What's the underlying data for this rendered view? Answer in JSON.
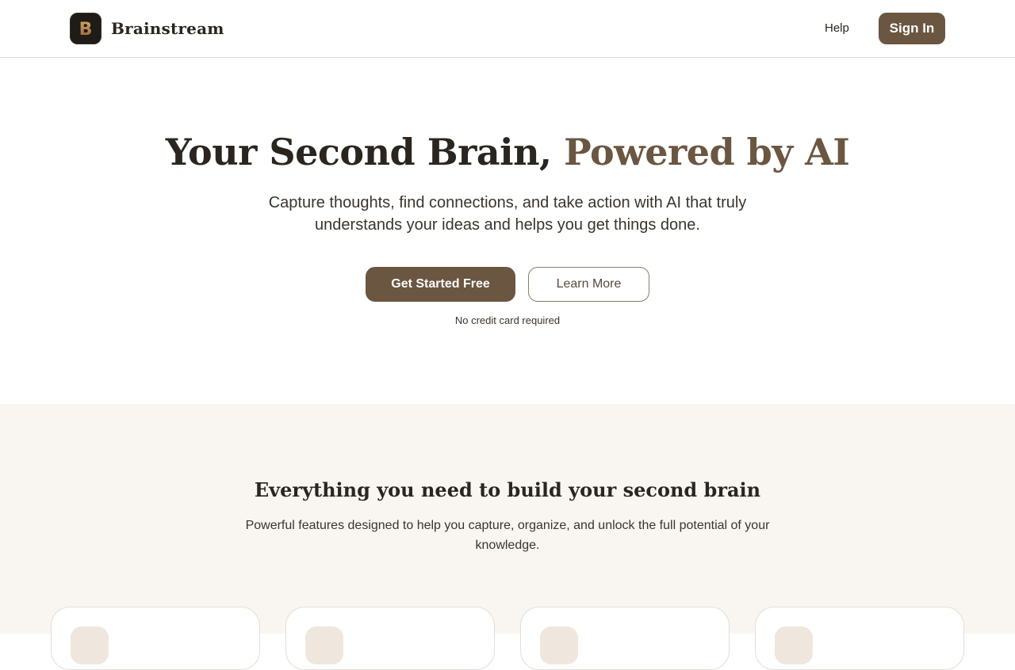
{
  "header": {
    "brand_name": "Brainstream",
    "logo_letter": "B",
    "help_label": "Help",
    "signin_label": "Sign In"
  },
  "hero": {
    "title_main": "Your Second Brain, ",
    "title_accent": "Powered by AI",
    "subtitle": "Capture thoughts, find connections, and take action with AI that truly understands your ideas and helps you get things done.",
    "primary_cta": "Get Started Free",
    "secondary_cta": "Learn More",
    "note": "No credit card required"
  },
  "features": {
    "title": "Everything you need to build your second brain",
    "subtitle": "Powerful features designed to help you capture, organize, and unlock the full potential of your knowledge.",
    "cards": [
      {
        "icon": "feature-icon"
      },
      {
        "icon": "feature-icon"
      },
      {
        "icon": "feature-icon"
      },
      {
        "icon": "feature-icon"
      }
    ]
  },
  "colors": {
    "accent": "#6b5641",
    "text": "#2b2520",
    "section_bg": "#f9f6f2"
  }
}
